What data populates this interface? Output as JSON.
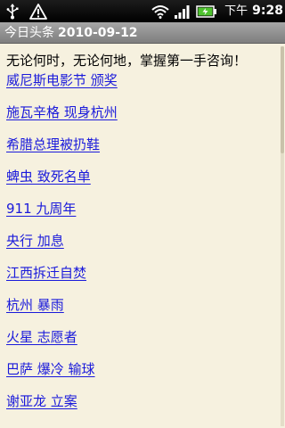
{
  "status_bar": {
    "icons": [
      "usb-icon",
      "warning-icon",
      "wifi-icon",
      "signal-icon",
      "battery-icon"
    ],
    "ampm": "下午",
    "time": "9:28"
  },
  "title_bar": {
    "app_name": "今日头条",
    "date": "2010-09-12"
  },
  "content": {
    "tagline": "无论何时，无论何地，掌握第一手咨询！",
    "link_color": "#1a1adb",
    "news": [
      {
        "label": "威尼斯电影节 颁奖"
      },
      {
        "label": "施瓦辛格 现身杭州"
      },
      {
        "label": "希腊总理被扔鞋"
      },
      {
        "label": "蜱虫 致死名单"
      },
      {
        "label": "911 九周年"
      },
      {
        "label": "央行 加息"
      },
      {
        "label": "江西拆迁自焚"
      },
      {
        "label": "杭州 暴雨"
      },
      {
        "label": "火星 志愿者"
      },
      {
        "label": "巴萨 爆冷 输球"
      },
      {
        "label": "谢亚龙 立案"
      }
    ]
  },
  "colors": {
    "background": "#f6f1df",
    "title_bar": "#8e8e8e",
    "status_bar": "#000000"
  }
}
